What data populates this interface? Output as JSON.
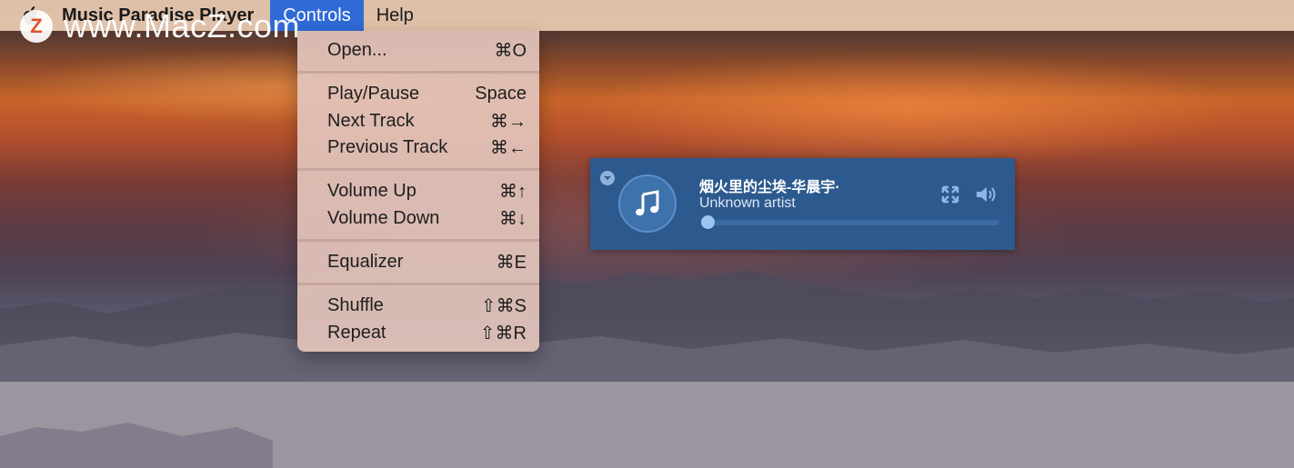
{
  "menubar": {
    "app_name": "Music Paradise Player",
    "menus": [
      "Controls",
      "Help"
    ],
    "active_menu": "Controls"
  },
  "watermark": {
    "logo_letter": "Z",
    "text": "www.MacZ.com"
  },
  "controls_menu": {
    "items": [
      {
        "label": "Open...",
        "shortcut": "⌘O"
      },
      {
        "label": "Play/Pause",
        "shortcut": "Space"
      },
      {
        "label": "Next Track",
        "shortcut": "⌘→"
      },
      {
        "label": "Previous Track",
        "shortcut": "⌘←"
      },
      {
        "label": "Volume Up",
        "shortcut": "⌘↑"
      },
      {
        "label": "Volume Down",
        "shortcut": "⌘↓"
      },
      {
        "label": "Equalizer",
        "shortcut": "⌘E"
      },
      {
        "label": "Shuffle",
        "shortcut": "⇧⌘S"
      },
      {
        "label": "Repeat",
        "shortcut": "⇧⌘R"
      }
    ]
  },
  "player": {
    "title": "烟火里的尘埃-华晨宇·",
    "artist": "Unknown artist",
    "progress": 0,
    "colors": {
      "background": "#2d5a8e",
      "accent": "#9cc4f2"
    },
    "icons": {
      "collapse": "chevron-down-icon",
      "art": "music-note-icon",
      "expand": "expand-icon",
      "volume": "speaker-icon"
    }
  },
  "colors": {
    "menu_highlight": "#2f6ad6",
    "menubar": "#eccdb4"
  }
}
